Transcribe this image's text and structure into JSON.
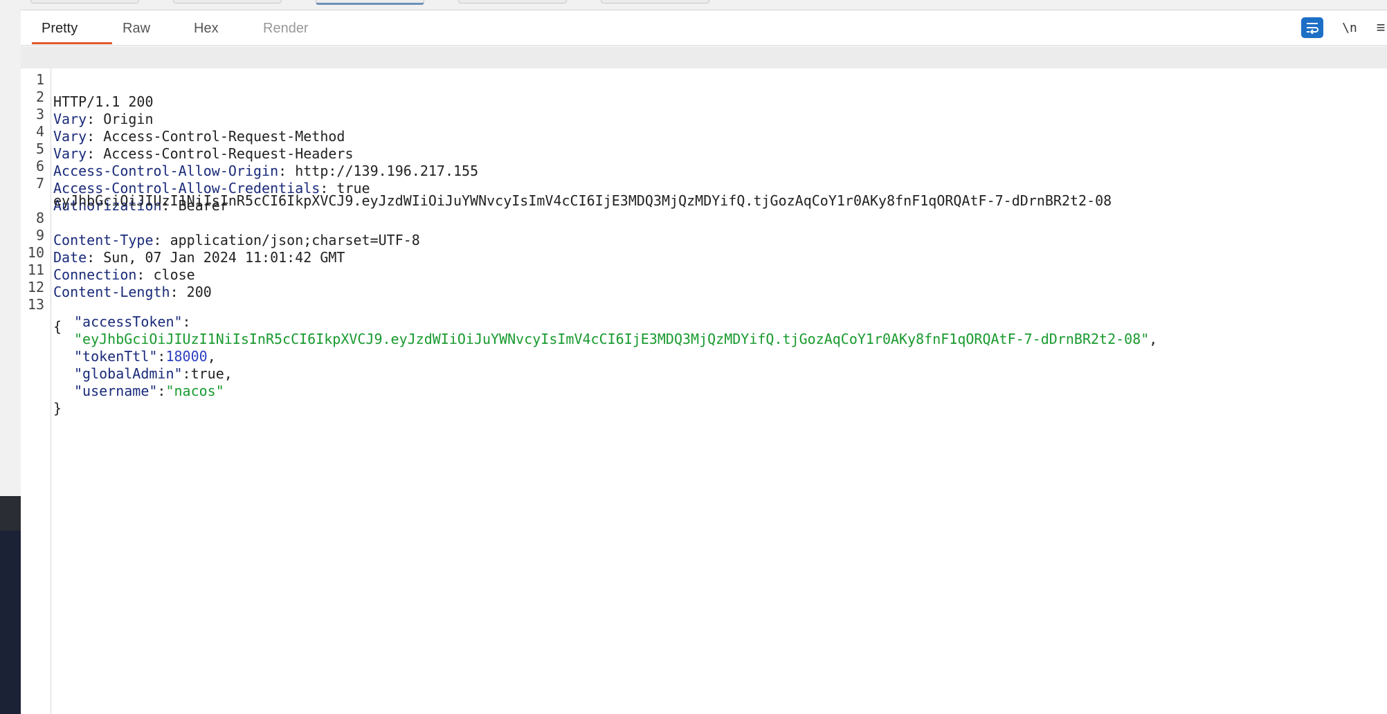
{
  "tabs": [
    {
      "label": "Pretty",
      "active": true
    },
    {
      "label": "Raw",
      "active": false
    },
    {
      "label": "Hex",
      "active": false
    },
    {
      "label": "Render",
      "active": false,
      "disabled": true
    }
  ],
  "toolbar": {
    "wrap_icon": "wrap-lines-icon",
    "newline_label": "\\n",
    "menu_icon": "hamburger-menu-icon"
  },
  "response": {
    "status_line": "HTTP/1.1 200",
    "headers": [
      {
        "name": "Vary",
        "value": "Origin"
      },
      {
        "name": "Vary",
        "value": "Access-Control-Request-Method"
      },
      {
        "name": "Vary",
        "value": "Access-Control-Request-Headers"
      },
      {
        "name": "Access-Control-Allow-Origin",
        "value": "http://139.196.217.155"
      },
      {
        "name": "Access-Control-Allow-Credentials",
        "value": "true"
      },
      {
        "name": "Authorization",
        "value": "Bearer",
        "continuation": "eyJhbGciOiJIUzI1NiIsInR5cCI6IkpXVCJ9.eyJzdWIiOiJuYWNvcyIsImV4cCI6IjE3MDQ3MjQzMDYifQ.tjGozAqCoY1r0AKy8fnF1qORQAtF-7-dDrnBR2t2-08"
      },
      {
        "name": "Content-Type",
        "value": "application/json;charset=UTF-8"
      },
      {
        "name": "Date",
        "value": "Sun, 07 Jan 2024 11:01:42 GMT"
      },
      {
        "name": "Connection",
        "value": "close"
      },
      {
        "name": "Content-Length",
        "value": "200"
      }
    ],
    "line_numbers": [
      "1",
      "2",
      "3",
      "4",
      "5",
      "6",
      "7",
      "8",
      "9",
      "10",
      "11",
      "12",
      "13"
    ],
    "body": {
      "open_brace": "{",
      "close_brace": "}",
      "fields": [
        {
          "key": "\"accessToken\"",
          "value": "\"eyJhbGciOiJIUzI1NiIsInR5cCI6IkpXVCJ9.eyJzdWIiOiJuYWNvcyIsImV4cCI6IjE3MDQ3MjQzMDYifQ.tjGozAqCoY1r0AKy8fnF1qORQAtF-7-dDrnBR2t2-08\"",
          "type": "string",
          "wrapped": true
        },
        {
          "key": "\"tokenTtl\"",
          "value": "18000",
          "type": "number"
        },
        {
          "key": "\"globalAdmin\"",
          "value": "true",
          "type": "bool"
        },
        {
          "key": "\"username\"",
          "value": "\"nacos\"",
          "type": "string"
        }
      ]
    }
  },
  "colors": {
    "active_tab_underline": "#e2572b",
    "header_key": "#1a2a7a",
    "json_string": "#189a2e",
    "json_number": "#2b3fbf",
    "wrap_button": "#1d6fc5"
  }
}
